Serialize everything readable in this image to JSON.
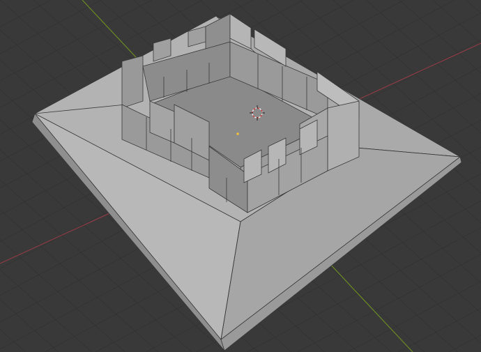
{
  "viewport": {
    "view": "3d-viewport",
    "shading": "solid",
    "colors": {
      "background": "#393939",
      "grid": "#2b2b2b",
      "x_axis": "#8e3b46",
      "y_axis": "#6d8a23",
      "mesh_light": "#b4b4b4",
      "mesh_mid": "#a3a3a3",
      "mesh_dark": "#8c8c8c",
      "edges": "#3a3a3a"
    },
    "objects": [
      {
        "name": "base-plinth",
        "type": "truncated-pyramid"
      },
      {
        "name": "castle-walls",
        "type": "crenellated-wall-ring"
      }
    ],
    "cursor": {
      "icon": "3d-cursor-icon"
    }
  }
}
